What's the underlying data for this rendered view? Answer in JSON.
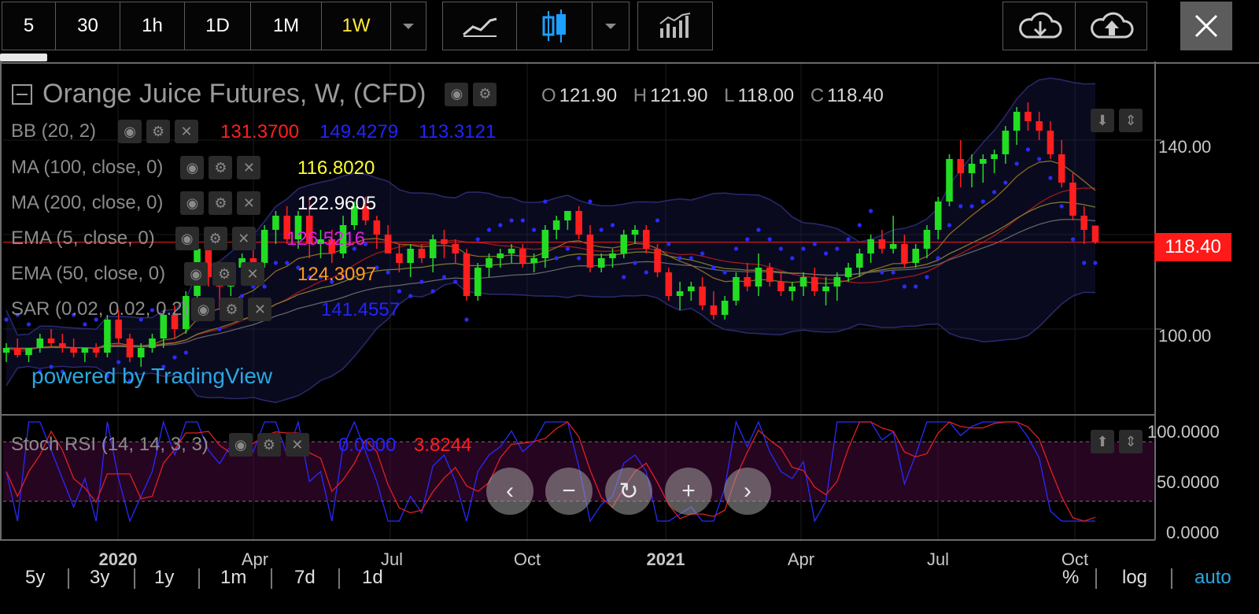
{
  "toolbar": {
    "intervals": [
      "5",
      "30",
      "1h",
      "1D",
      "1M",
      "1W"
    ],
    "active_interval": "1W"
  },
  "legend": {
    "symbol": "Orange Juice Futures, W, (CFD)",
    "ohlc": {
      "o_label": "O",
      "o": "121.90",
      "h_label": "H",
      "h": "121.90",
      "l_label": "L",
      "l": "118.00",
      "c_label": "C",
      "c": "118.40"
    },
    "indicators": [
      {
        "name": "BB (20, 2)",
        "values": [
          "131.3700",
          "149.4279",
          "113.3121"
        ],
        "colors": [
          "#ff2020",
          "#2323ff",
          "#2323ff"
        ]
      },
      {
        "name": "MA (100, close, 0)",
        "values": [
          "116.8020"
        ],
        "colors": [
          "#ffff33"
        ]
      },
      {
        "name": "MA (200, close, 0)",
        "values": [
          "122.9605"
        ],
        "colors": [
          "#ffffff"
        ]
      },
      {
        "name": "EMA (5, close, 0)",
        "values": [
          "126.5216"
        ],
        "colors": [
          "#e020e0"
        ]
      },
      {
        "name": "EMA (50, close, 0)",
        "values": [
          "124.3097"
        ],
        "colors": [
          "#ff9a1a"
        ]
      },
      {
        "name": "SAR (0.02, 0.02, 0.2)",
        "values": [
          "141.4557"
        ],
        "colors": [
          "#2323ff"
        ]
      }
    ],
    "oscillator": {
      "name": "Stoch RSI (14, 14, 3, 3)",
      "values": [
        "0.0000",
        "3.8244"
      ],
      "colors": [
        "#2323ff",
        "#ff2020"
      ]
    }
  },
  "powered_by": "powered by TradingView",
  "last_price": "118.40",
  "price_axis": {
    "labels": [
      "140.00",
      "100.00"
    ]
  },
  "osc_axis": {
    "labels": [
      "100.0000",
      "50.0000",
      "0.0000"
    ]
  },
  "time_axis": {
    "labels": [
      "2020",
      "Apr",
      "Jul",
      "Oct",
      "2021",
      "Apr",
      "Jul",
      "Oct"
    ]
  },
  "ranges": [
    "5y",
    "3y",
    "1y",
    "1m",
    "7d",
    "1d"
  ],
  "scale": {
    "percent": "%",
    "log": "log",
    "auto": "auto"
  },
  "colors": {
    "up": "#22dd22",
    "down": "#ff1e1e",
    "bb": "#2a2aff",
    "accent": "#ffeb3b",
    "tv_blue": "#29a8e0"
  },
  "chart_data": {
    "type": "candlestick",
    "title": "Orange Juice Futures, W, (CFD)",
    "x_range": [
      "2019-10",
      "2021-11"
    ],
    "ylim": [
      88,
      155
    ],
    "y_scale": "linear",
    "grid": true,
    "last_close": 118.4,
    "candles_weekly_approx": [
      [
        95,
        97,
        93,
        96
      ],
      [
        96,
        98,
        94,
        94.5
      ],
      [
        94.5,
        96,
        93,
        96
      ],
      [
        96,
        99,
        95,
        98
      ],
      [
        98,
        100,
        96,
        97
      ],
      [
        97,
        99,
        95,
        96
      ],
      [
        96,
        98,
        94,
        95
      ],
      [
        95,
        96,
        93,
        96
      ],
      [
        96,
        97,
        94,
        95
      ],
      [
        95,
        103,
        94,
        102
      ],
      [
        102,
        104,
        97,
        98
      ],
      [
        98,
        99,
        93,
        94
      ],
      [
        94,
        97,
        92,
        96
      ],
      [
        96,
        99,
        95,
        98
      ],
      [
        98,
        104,
        96,
        103
      ],
      [
        103,
        105,
        98,
        100
      ],
      [
        100,
        108,
        99,
        107
      ],
      [
        107,
        119,
        106,
        117
      ],
      [
        117,
        118,
        109,
        111
      ],
      [
        111,
        113,
        104,
        109
      ],
      [
        109,
        114,
        107,
        113
      ],
      [
        113,
        116,
        111,
        115
      ],
      [
        115,
        117,
        113,
        114
      ],
      [
        114,
        122,
        113,
        121
      ],
      [
        121,
        125,
        118,
        124
      ],
      [
        124,
        126,
        118,
        119
      ],
      [
        119,
        125,
        117,
        124
      ],
      [
        124,
        128,
        115,
        118
      ],
      [
        118,
        121,
        115,
        119
      ],
      [
        119,
        121,
        114,
        116
      ],
      [
        116,
        124,
        115,
        122
      ],
      [
        122,
        127,
        121,
        126
      ],
      [
        126,
        128,
        122,
        123
      ],
      [
        123,
        124,
        117,
        120
      ],
      [
        120,
        122,
        116,
        116
      ],
      [
        116,
        118,
        112,
        114
      ],
      [
        114,
        118,
        111,
        117
      ],
      [
        117,
        118,
        114,
        115
      ],
      [
        115,
        120,
        112,
        119
      ],
      [
        119,
        121,
        115,
        118
      ],
      [
        118,
        119,
        114,
        116
      ],
      [
        116,
        117,
        106,
        107
      ],
      [
        107,
        114,
        106,
        113
      ],
      [
        113,
        116,
        111,
        115
      ],
      [
        115,
        117,
        113,
        116
      ],
      [
        116,
        118,
        114,
        117
      ],
      [
        117,
        118,
        113,
        114
      ],
      [
        114,
        116,
        112,
        115
      ],
      [
        115,
        122,
        113,
        121
      ],
      [
        121,
        124,
        119,
        123
      ],
      [
        123,
        125,
        121,
        125
      ],
      [
        125,
        126,
        119,
        120
      ],
      [
        120,
        122,
        112,
        113
      ],
      [
        113,
        116,
        112,
        115
      ],
      [
        115,
        117,
        113,
        116
      ],
      [
        116,
        121,
        115,
        120
      ],
      [
        120,
        122,
        118,
        121
      ],
      [
        121,
        122,
        116,
        117
      ],
      [
        117,
        118,
        111,
        112
      ],
      [
        112,
        113,
        106,
        107
      ],
      [
        107,
        110,
        104,
        108
      ],
      [
        108,
        110,
        106,
        109
      ],
      [
        109,
        111,
        104,
        105
      ],
      [
        105,
        108,
        102,
        103
      ],
      [
        103,
        107,
        102,
        106
      ],
      [
        106,
        112,
        105,
        111
      ],
      [
        111,
        114,
        108,
        109
      ],
      [
        109,
        116,
        107,
        113
      ],
      [
        113,
        114,
        109,
        110
      ],
      [
        110,
        112,
        107,
        108
      ],
      [
        108,
        110,
        106,
        109
      ],
      [
        109,
        112,
        107,
        111
      ],
      [
        111,
        113,
        107,
        108
      ],
      [
        108,
        111,
        105,
        109
      ],
      [
        109,
        112,
        106,
        111
      ],
      [
        111,
        114,
        110,
        113
      ],
      [
        113,
        117,
        111,
        116
      ],
      [
        116,
        120,
        114,
        119
      ],
      [
        119,
        121,
        116,
        117
      ],
      [
        117,
        124,
        116,
        118
      ],
      [
        118,
        120,
        113,
        114
      ],
      [
        114,
        118,
        113,
        117
      ],
      [
        117,
        122,
        115,
        121
      ],
      [
        121,
        128,
        119,
        127
      ],
      [
        127,
        137,
        126,
        136
      ],
      [
        136,
        140,
        130,
        133
      ],
      [
        133,
        137,
        130,
        135
      ],
      [
        135,
        137,
        131,
        136
      ],
      [
        136,
        138,
        133,
        137
      ],
      [
        137,
        143,
        135,
        142
      ],
      [
        142,
        147,
        139,
        146
      ],
      [
        146,
        148,
        142,
        144
      ],
      [
        144,
        146,
        140,
        142
      ],
      [
        142,
        144,
        136,
        137
      ],
      [
        137,
        140,
        130,
        131
      ],
      [
        131,
        133,
        123,
        124
      ],
      [
        124,
        126,
        118,
        121
      ],
      [
        121.9,
        121.9,
        118,
        118.4
      ]
    ]
  }
}
